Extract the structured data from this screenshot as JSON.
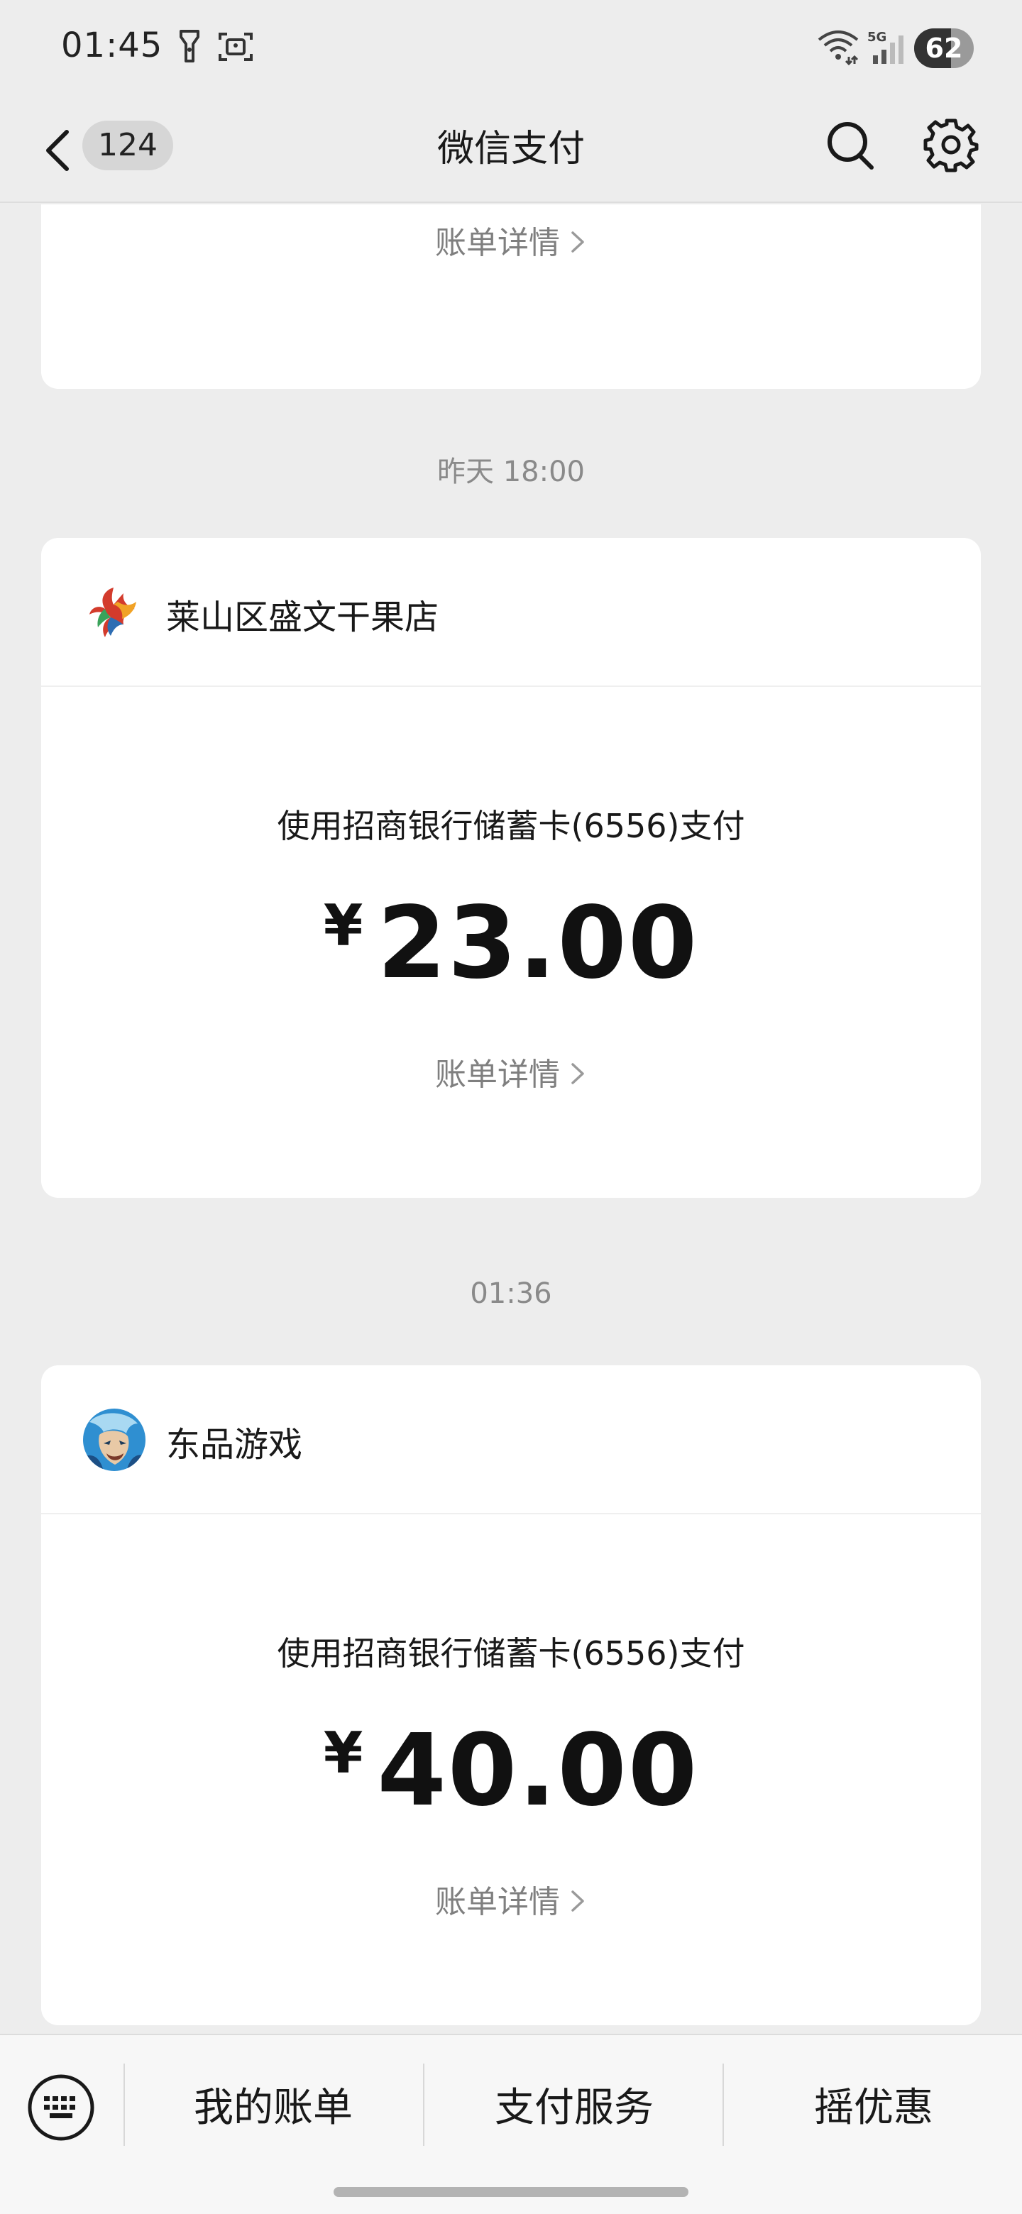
{
  "status_bar": {
    "time": "01:45",
    "battery": "62",
    "battery_level": 0.62,
    "network": "5G",
    "icons": [
      "flashlight-icon",
      "screenshot-icon",
      "wifi-icon",
      "signal-icon",
      "battery-icon"
    ]
  },
  "nav": {
    "unread_count": "124",
    "title": "微信支付",
    "icons": [
      "back-arrow-icon",
      "search-icon",
      "gear-icon"
    ]
  },
  "messages": [
    {
      "partial": true,
      "bill_link": "账单详情"
    },
    {
      "time": "昨天 18:00",
      "merchant": "莱山区盛文干果店",
      "pay_method": "使用招商银行储蓄卡(6556)支付",
      "currency": "¥",
      "amount": "23.00",
      "bill_link": "账单详情"
    },
    {
      "time": "01:36",
      "merchant": "东品游戏",
      "pay_method": "使用招商银行储蓄卡(6556)支付",
      "currency": "¥",
      "amount": "40.00",
      "bill_link": "账单详情"
    }
  ],
  "bottom_menu": {
    "items": [
      "我的账单",
      "支付服务",
      "摇优惠"
    ],
    "keyboard_icon": "keyboard-icon"
  },
  "colors": {
    "background": "#ededed",
    "card": "#ffffff",
    "secondary_text": "#7f7f7f"
  }
}
